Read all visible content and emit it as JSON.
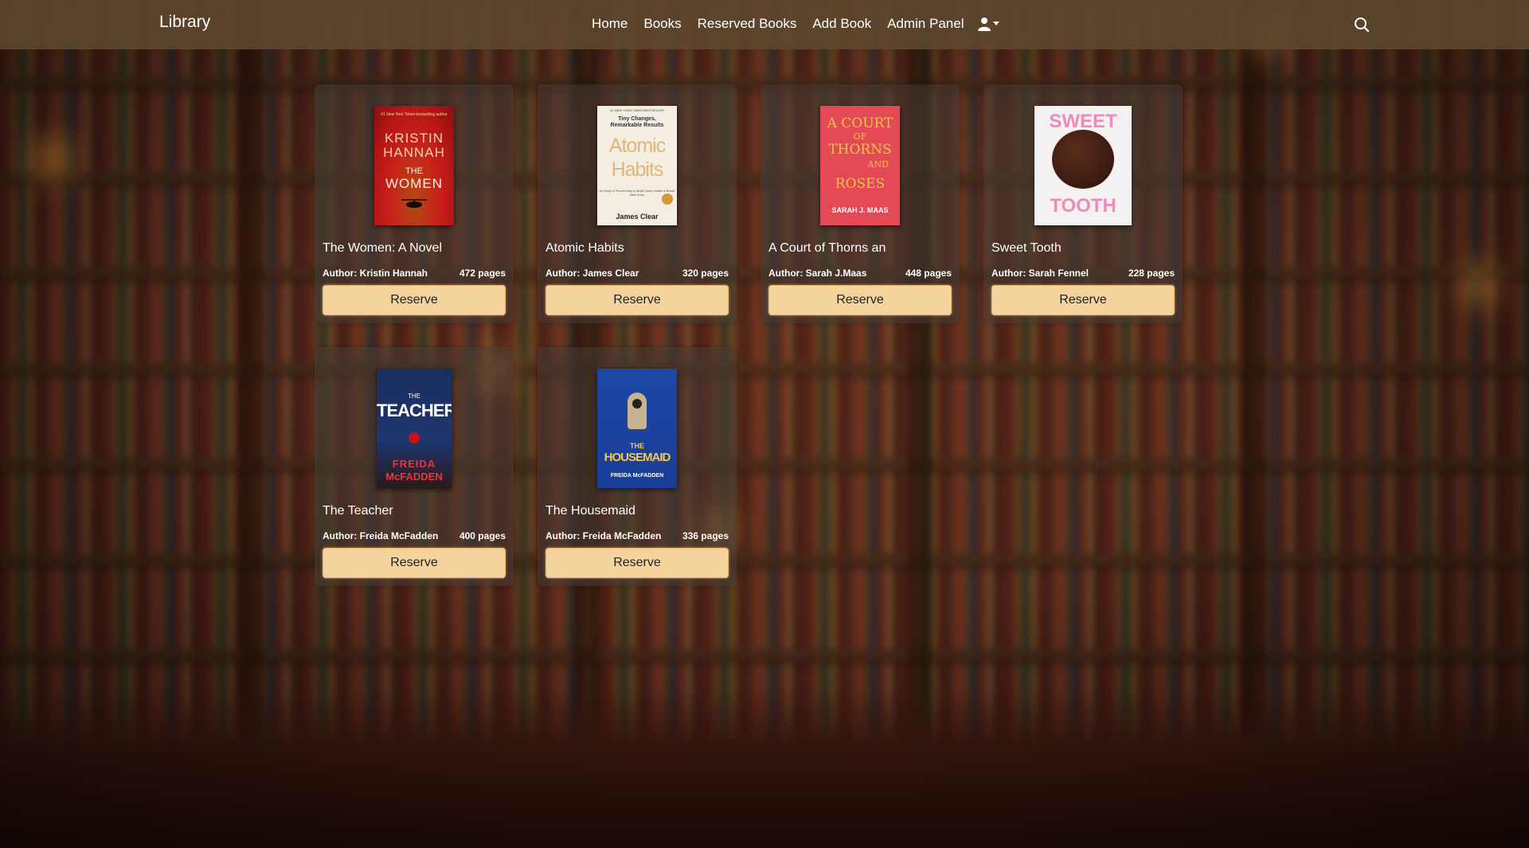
{
  "nav": {
    "brand": "Library",
    "links": [
      "Home",
      "Books",
      "Reserved Books",
      "Add Book",
      "Admin Panel"
    ]
  },
  "icons": {
    "user": "user-icon",
    "dropdown": "caret-down-icon",
    "search": "search-icon"
  },
  "colors": {
    "navbar": "#5f482e",
    "reserve_button": "#f5d39c",
    "card_bg": "#463a34"
  },
  "books": [
    {
      "title": "The Women: A Novel",
      "author": "Author: Kristin Hannah",
      "pages": "472 pages",
      "button": "Reserve",
      "cover": {
        "line1": "KRISTIN",
        "line2": "HANNAH",
        "line3": "THE",
        "line4": "WOMEN"
      }
    },
    {
      "title": "Atomic Habits",
      "author": "Author: James Clear",
      "pages": "320 pages",
      "button": "Reserve",
      "cover": {
        "line1": "Tiny Changes,",
        "line2": "Remarkable Results",
        "line3": "Atomic",
        "line4": "Habits",
        "author": "James Clear"
      }
    },
    {
      "title": "A Court of Thorns an",
      "author": "Author: Sarah J.Maas",
      "pages": "448 pages",
      "button": "Reserve",
      "cover": {
        "line1": "A COURT",
        "line2": "OF",
        "line3": "THORNS",
        "line4": "AND",
        "line5": "ROSES",
        "author": "SARAH J. MAAS"
      }
    },
    {
      "title": "Sweet Tooth",
      "author": "Author: Sarah Fennel",
      "pages": "228 pages",
      "button": "Reserve",
      "cover": {
        "line1": "SWEET",
        "line2": "TOOTH"
      }
    },
    {
      "title": "The Teacher",
      "author": "Author: Freida McFadden",
      "pages": "400 pages",
      "button": "Reserve",
      "cover": {
        "line1": "THE",
        "line2": "TEACHER",
        "line3": "FREIDA",
        "line4": "McFADDEN"
      }
    },
    {
      "title": "The Housemaid",
      "author": "Author: Freida McFadden",
      "pages": "336 pages",
      "button": "Reserve",
      "cover": {
        "line1": "THE",
        "line2": "HOUSEMAID",
        "line3": "FREIDA McFADDEN"
      }
    }
  ]
}
